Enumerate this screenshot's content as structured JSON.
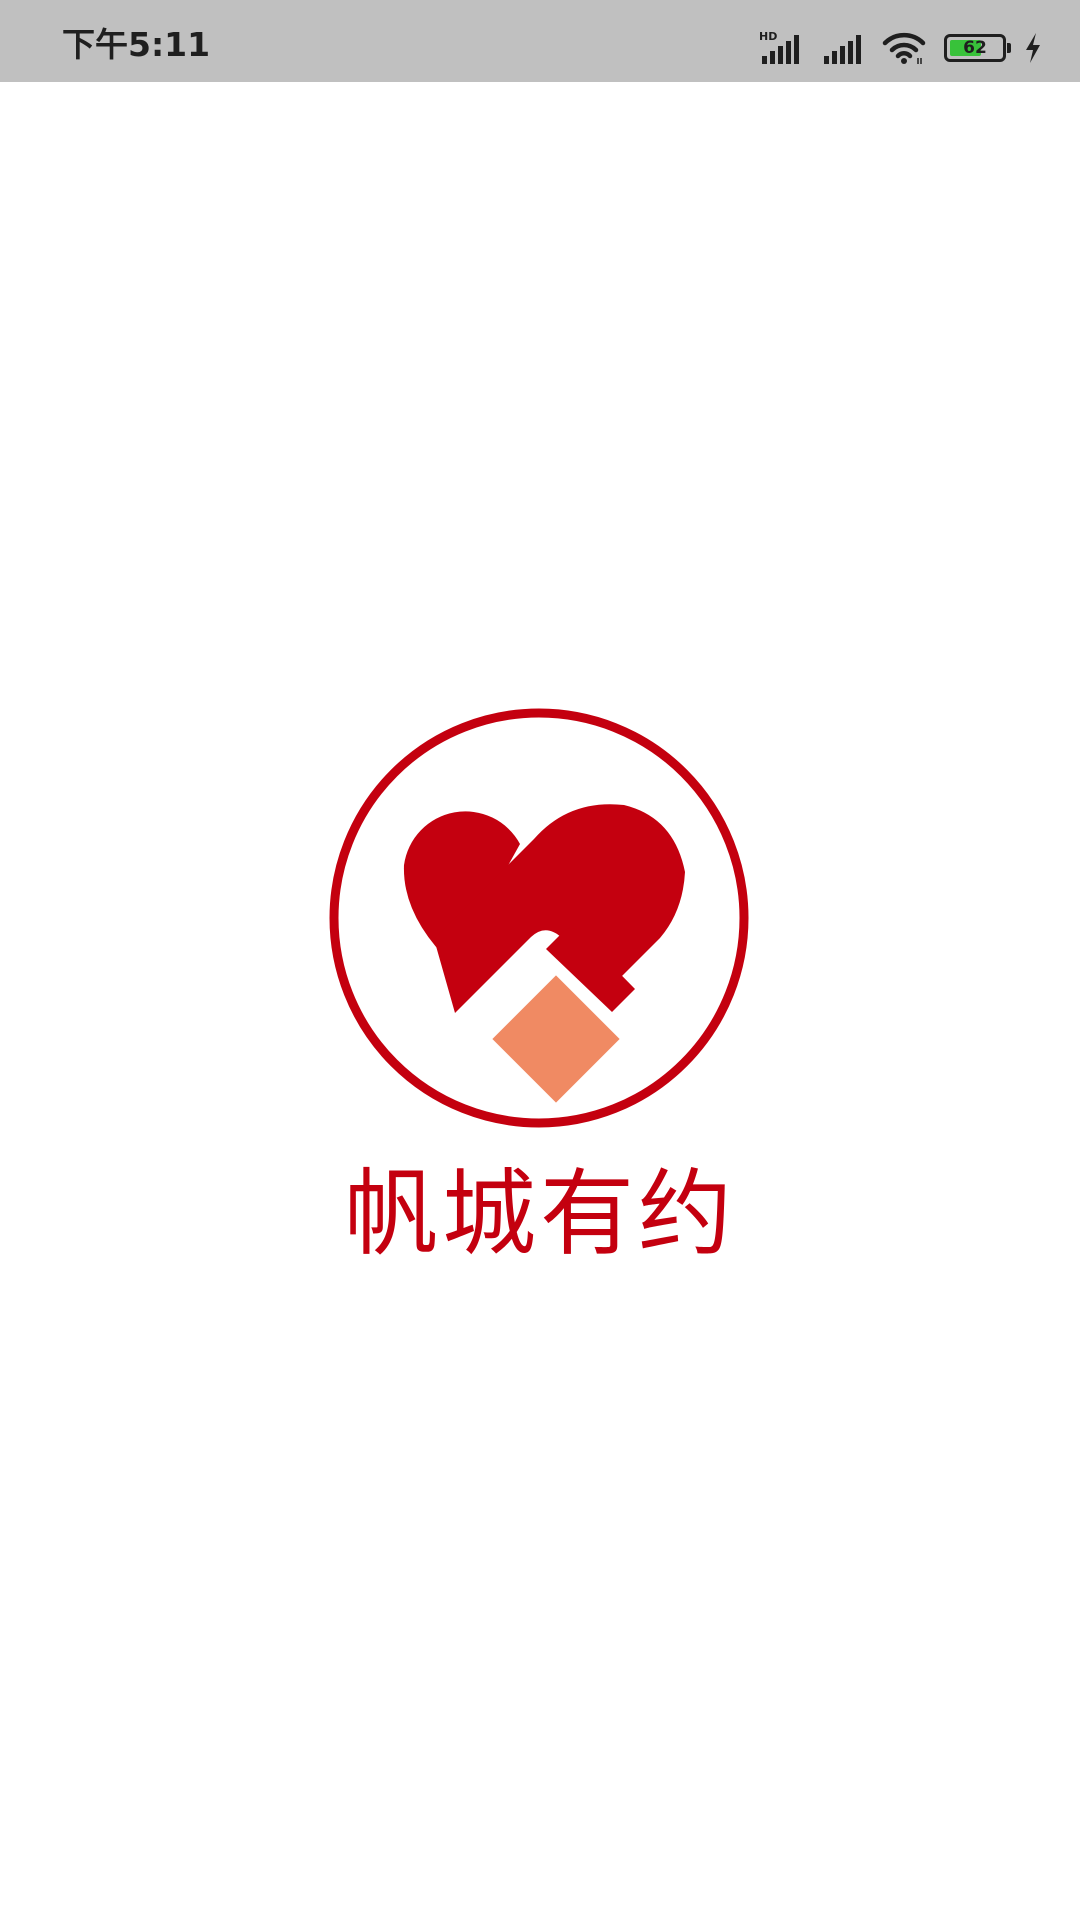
{
  "status_bar": {
    "time": "下午5:11",
    "network_label": "HD",
    "battery_level": "62",
    "battery_fraction": 0.62,
    "icons": [
      "hd-signal-icon",
      "signal-icon",
      "wifi-icon",
      "battery-icon",
      "charging-icon"
    ]
  },
  "splash": {
    "app_name": "帆城有约",
    "logo_icon": "heart-handshake-logo",
    "colors": {
      "brand_red": "#c4000f",
      "accent_orange": "#f08a63",
      "background": "#ffffff"
    }
  }
}
